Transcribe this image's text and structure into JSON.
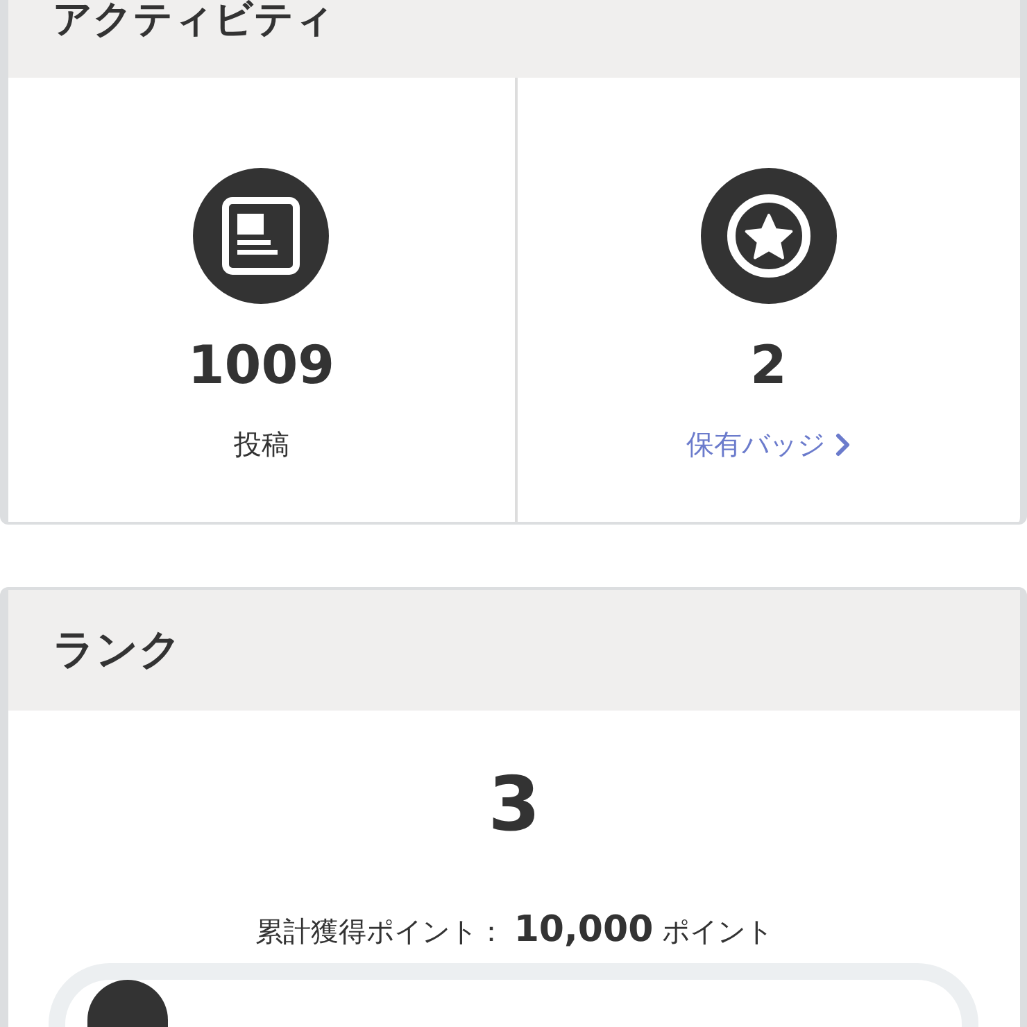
{
  "activity": {
    "title": "アクティビティ",
    "stats": [
      {
        "kind": "posts",
        "value": "1009",
        "label": "投稿",
        "link": false
      },
      {
        "kind": "badges",
        "value": "2",
        "label": "保有バッジ",
        "link": true
      }
    ]
  },
  "rank": {
    "title": "ランク",
    "value": "3",
    "points": "累計獲得ポイント： **10,000** ポイント",
    "progress": {
      "level": 0.09
    }
  }
}
